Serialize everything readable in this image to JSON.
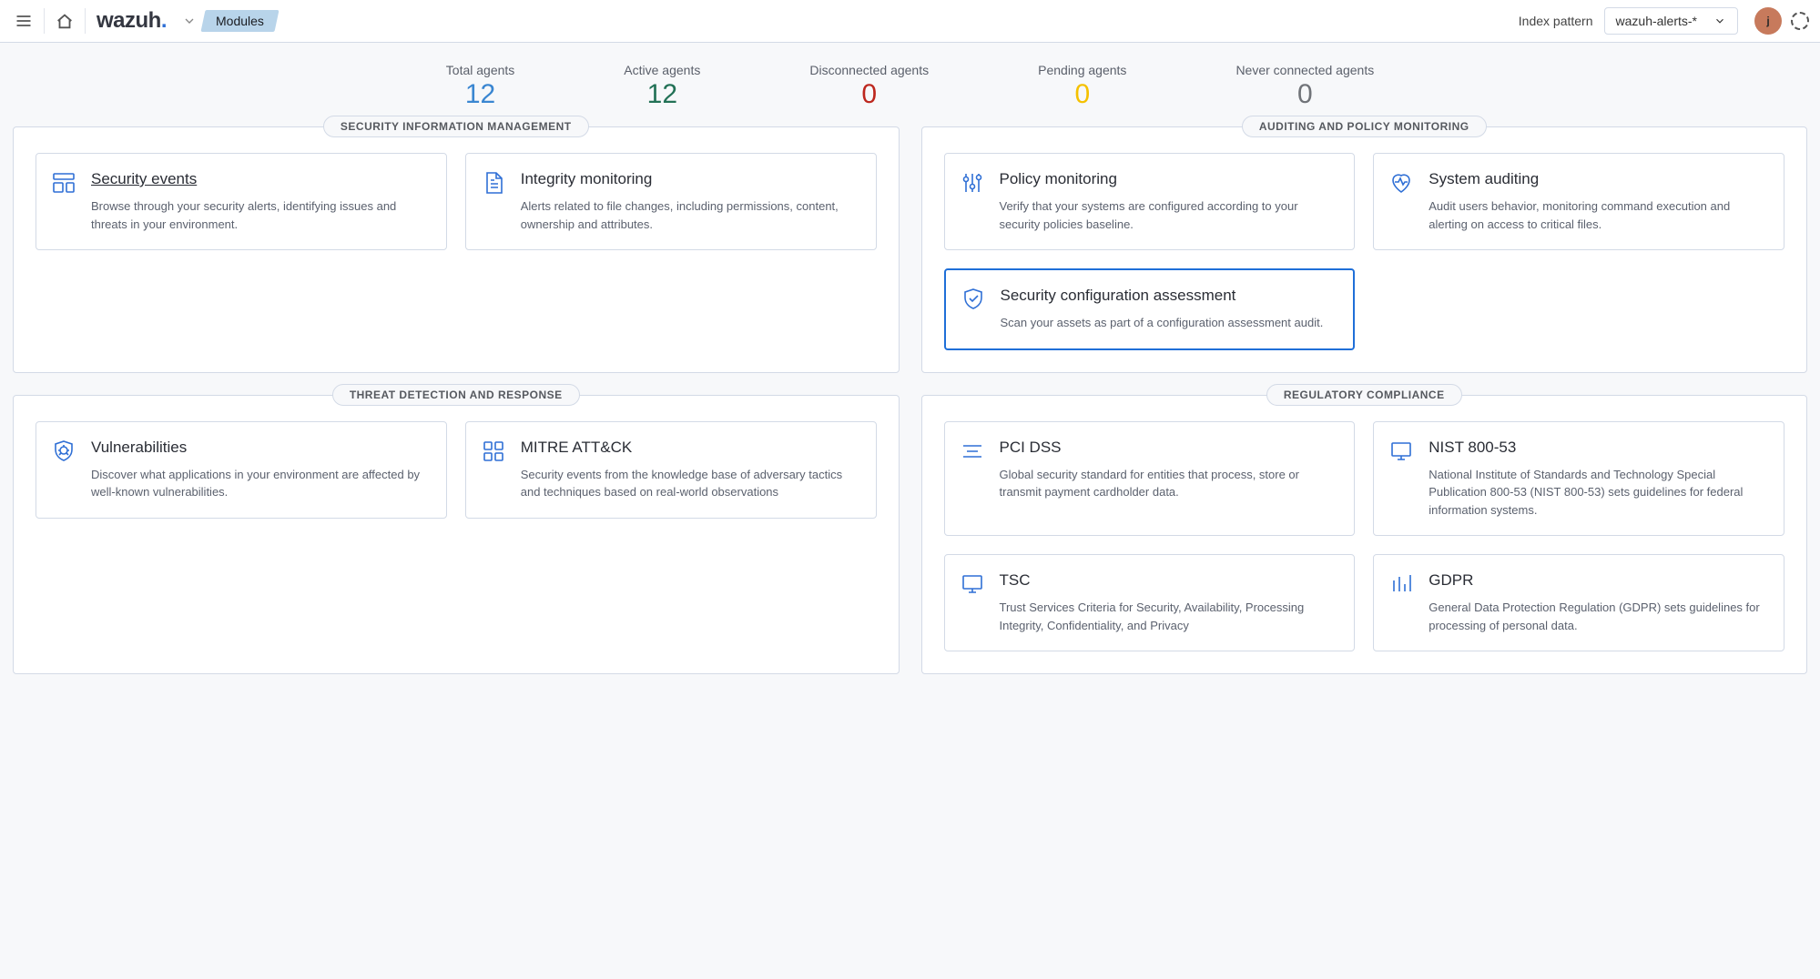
{
  "header": {
    "logo_text": "wazuh",
    "logo_dot": ".",
    "breadcrumb_current": "Modules",
    "index_pattern_label": "Index pattern",
    "index_pattern_value": "wazuh-alerts-*",
    "avatar_initial": "j"
  },
  "stats": [
    {
      "label": "Total agents",
      "value": "12",
      "color": "v-blue"
    },
    {
      "label": "Active agents",
      "value": "12",
      "color": "v-green"
    },
    {
      "label": "Disconnected agents",
      "value": "0",
      "color": "v-red"
    },
    {
      "label": "Pending agents",
      "value": "0",
      "color": "v-yellow"
    },
    {
      "label": "Never connected agents",
      "value": "0",
      "color": "v-grey"
    }
  ],
  "panels": {
    "sim": {
      "title": "SECURITY INFORMATION MANAGEMENT",
      "cards": [
        {
          "icon": "dashboard-icon",
          "title": "Security events",
          "desc": "Browse through your security alerts, identifying issues and threats in your environment.",
          "underline": true
        },
        {
          "icon": "file-icon",
          "title": "Integrity monitoring",
          "desc": "Alerts related to file changes, including permissions, content, ownership and attributes."
        }
      ]
    },
    "apm": {
      "title": "AUDITING AND POLICY MONITORING",
      "cards": [
        {
          "icon": "sliders-icon",
          "title": "Policy monitoring",
          "desc": "Verify that your systems are configured according to your security policies baseline."
        },
        {
          "icon": "heartbeat-icon",
          "title": "System auditing",
          "desc": "Audit users behavior, monitoring command execution and alerting on access to critical files."
        },
        {
          "icon": "shieldcheck-icon",
          "title": "Security configuration assessment",
          "desc": "Scan your assets as part of a configuration assessment audit.",
          "selected": true
        }
      ]
    },
    "tdr": {
      "title": "THREAT DETECTION AND RESPONSE",
      "cards": [
        {
          "icon": "shieldbug-icon",
          "title": "Vulnerabilities",
          "desc": "Discover what applications in your environment are affected by well-known vulnerabilities."
        },
        {
          "icon": "grid-icon",
          "title": "MITRE ATT&CK",
          "desc": "Security events from the knowledge base of adversary tactics and techniques based on real-world observations"
        }
      ]
    },
    "rc": {
      "title": "REGULATORY COMPLIANCE",
      "cards": [
        {
          "icon": "lines-icon",
          "title": "PCI DSS",
          "desc": "Global security standard for entities that process, store or transmit payment cardholder data."
        },
        {
          "icon": "screen-icon",
          "title": "NIST 800-53",
          "desc": "National Institute of Standards and Technology Special Publication 800-53 (NIST 800-53) sets guidelines for federal information systems."
        },
        {
          "icon": "screen-icon",
          "title": "TSC",
          "desc": "Trust Services Criteria for Security, Availability, Processing Integrity, Confidentiality, and Privacy"
        },
        {
          "icon": "bars-icon",
          "title": "GDPR",
          "desc": "General Data Protection Regulation (GDPR) sets guidelines for processing of personal data."
        }
      ]
    }
  }
}
